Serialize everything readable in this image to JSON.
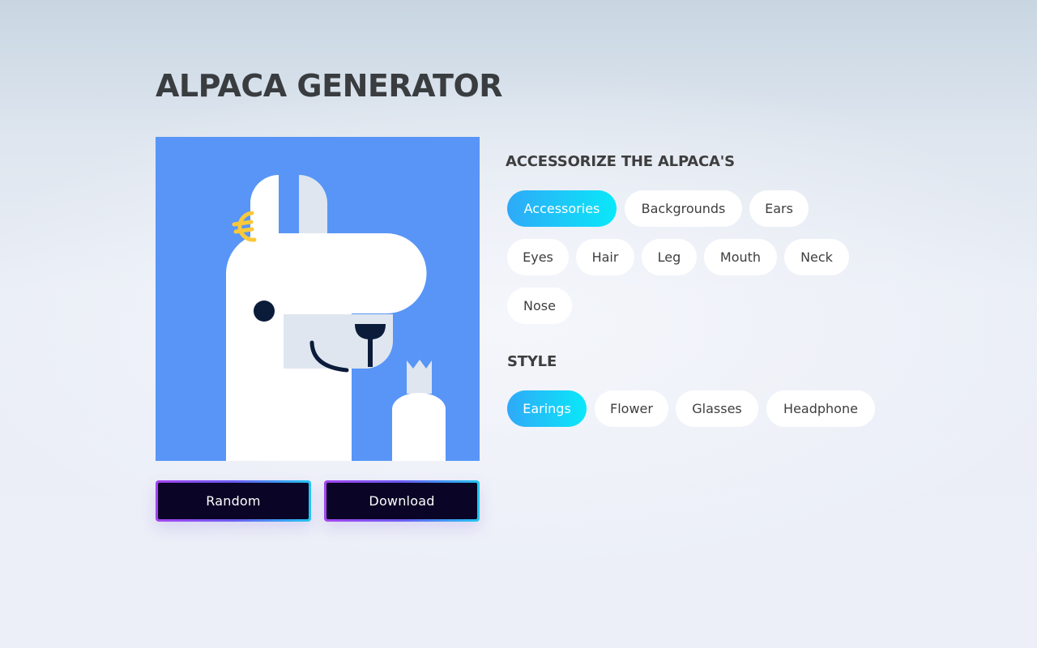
{
  "app": {
    "title": "ALPACA GENERATOR"
  },
  "preview": {
    "background_color": "#5895f7"
  },
  "actions": {
    "random_label": "Random",
    "download_label": "Download"
  },
  "accessorize": {
    "heading": "ACCESSORIZE THE ALPACA'S",
    "categories": [
      {
        "label": "Accessories",
        "selected": true
      },
      {
        "label": "Backgrounds",
        "selected": false
      },
      {
        "label": "Ears",
        "selected": false
      },
      {
        "label": "Eyes",
        "selected": false
      },
      {
        "label": "Hair",
        "selected": false
      },
      {
        "label": "Leg",
        "selected": false
      },
      {
        "label": "Mouth",
        "selected": false
      },
      {
        "label": "Neck",
        "selected": false
      },
      {
        "label": "Nose",
        "selected": false
      }
    ]
  },
  "style": {
    "heading": "STYLE",
    "options": [
      {
        "label": "Earings",
        "selected": true
      },
      {
        "label": "Flower",
        "selected": false
      },
      {
        "label": "Glasses",
        "selected": false
      },
      {
        "label": "Headphone",
        "selected": false
      }
    ]
  },
  "colors": {
    "accent_gradient_start": "#2fa9f8",
    "accent_gradient_end": "#0ae8f9",
    "button_dark": "#0a0526",
    "button_border_start": "#a545f0",
    "button_border_end": "#23c6f1",
    "alpaca_white": "#ffffff",
    "alpaca_gray": "#dfe6ef",
    "alpaca_dark": "#0b1b3a",
    "earring_yellow": "#f9c93b"
  }
}
